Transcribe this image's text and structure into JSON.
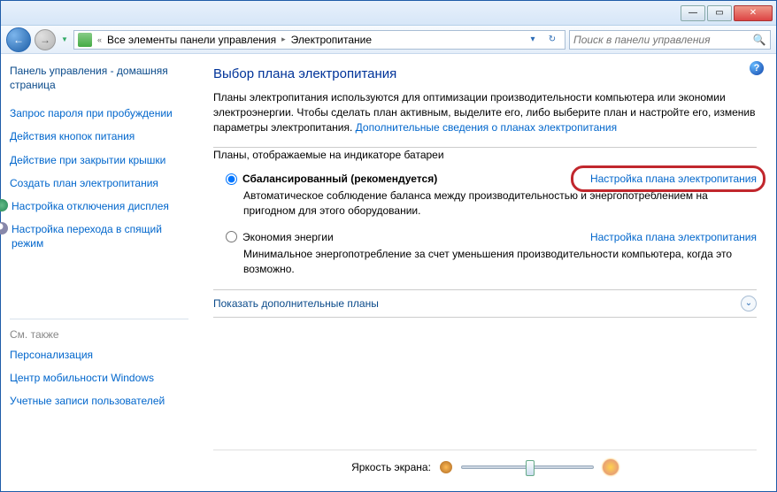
{
  "titlebar": {
    "min": "—",
    "max": "▭",
    "close": "✕"
  },
  "nav": {
    "back": "←",
    "fwd": "→",
    "drop": "▼",
    "breadcrumb_prefix": "«",
    "bc1": "Все элементы панели управления",
    "bc2": "Электропитание",
    "addr_drop": "▾",
    "refresh": "↻"
  },
  "search": {
    "placeholder": "Поиск в панели управления",
    "icon": "🔍"
  },
  "sidebar": {
    "home": "Панель управления - домашняя страница",
    "l1": "Запрос пароля при пробуждении",
    "l2": "Действия кнопок питания",
    "l3": "Действие при закрытии крышки",
    "l4": "Создать план электропитания",
    "l5": "Настройка отключения дисплея",
    "l6": "Настройка перехода в спящий режим",
    "see_also": "См. также",
    "s1": "Персонализация",
    "s2": "Центр мобильности Windows",
    "s3": "Учетные записи пользователей"
  },
  "main": {
    "help": "?",
    "title": "Выбор плана электропитания",
    "desc_pre": "Планы электропитания используются для оптимизации производительности компьютера или экономии электроэнергии. Чтобы сделать план активным, выделите его, либо выберите план и настройте его, изменив параметры электропитания. ",
    "desc_link": "Дополнительные сведения о планах электропитания",
    "fieldset_label": "Планы, отображаемые на индикаторе батареи",
    "plan1": {
      "name": "Сбалансированный (рекомендуется)",
      "link": "Настройка плана электропитания",
      "desc": "Автоматическое соблюдение баланса между производительностью и энергопотреблением на пригодном для этого оборудовании."
    },
    "plan2": {
      "name": "Экономия энергии",
      "link": "Настройка плана электропитания",
      "desc": "Минимальное энергопотребление за счет уменьшения производительности компьютера, когда это возможно."
    },
    "expander": "Показать дополнительные планы",
    "expander_icon": "⌄",
    "brightness_label": "Яркость экрана:"
  }
}
